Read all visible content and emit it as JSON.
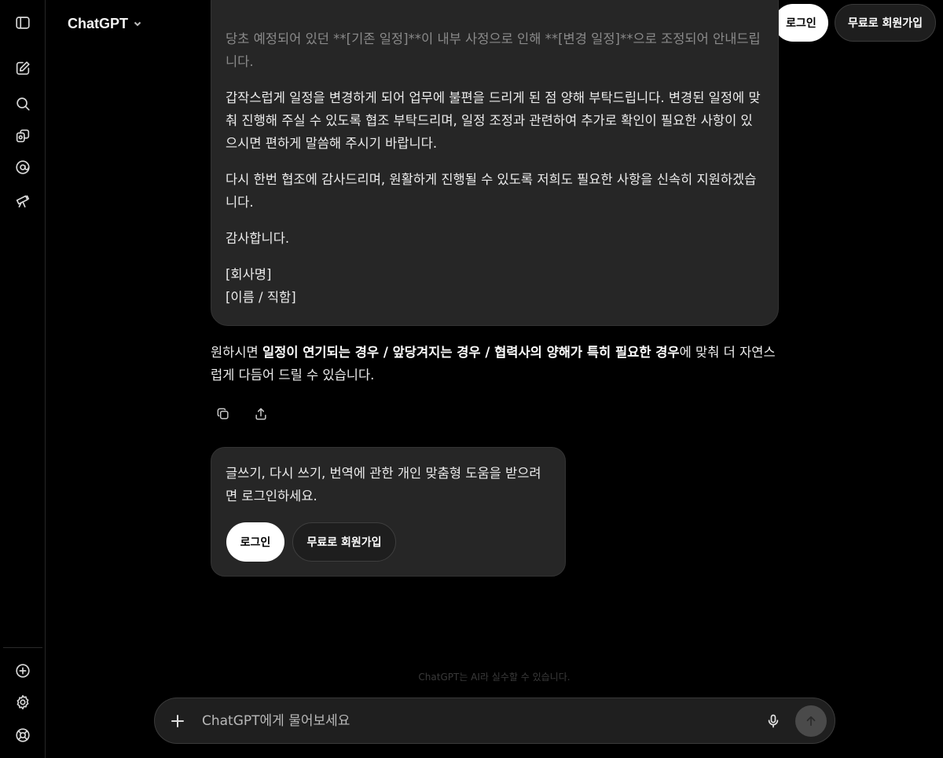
{
  "header": {
    "brand": "ChatGPT",
    "login_label": "로그인",
    "signup_label": "무료로 회원가입"
  },
  "sidebar": {
    "items": [
      {
        "icon": "sidebar-toggle-icon"
      },
      {
        "icon": "new-chat-icon"
      },
      {
        "icon": "search-icon"
      },
      {
        "icon": "library-icon"
      },
      {
        "icon": "mention-icon"
      },
      {
        "icon": "telescope-icon"
      }
    ],
    "bottom_items": [
      {
        "icon": "upgrade-icon"
      },
      {
        "icon": "gear-icon"
      },
      {
        "icon": "help-icon"
      }
    ]
  },
  "message": {
    "para1": "당초 예정되어 있던 **[기존 일정]**이 내부 사정으로 인해 **[변경 일정]**으로 조정되어 안내드립니다.",
    "para2": "갑작스럽게 일정을 변경하게 되어 업무에 불편을 드리게 된 점 양해 부탁드립니다. 변경된 일정에 맞춰 진행해 주실 수 있도록 협조 부탁드리며, 일정 조정과 관련하여 추가로 확인이 필요한 사항이 있으시면 편하게 말씀해 주시기 바랍니다.",
    "para3": "다시 한번 협조에 감사드리며, 원활하게 진행될 수 있도록 저희도 필요한 사항을 신속히 지원하겠습니다.",
    "para4": "감사합니다.",
    "sign_company": "[회사명]",
    "sign_name": "[이름 / 직함]"
  },
  "reply": {
    "prefix": "원하시면 ",
    "bold": "일정이 연기되는 경우 / 앞당겨지는 경우 / 협력사의 양해가 특히 필요한 경우",
    "suffix": "에 맞춰 더 자연스럽게 다듬어 드릴 수 있습니다."
  },
  "login_prompt": {
    "text": "글쓰기, 다시 쓰기, 번역에 관한 개인 맞춤형 도움을 받으려면 로그인하세요.",
    "login_label": "로그인",
    "signup_label": "무료로 회원가입"
  },
  "disclaimer": "ChatGPT는 AI라 실수할 수 있습니다.",
  "composer": {
    "placeholder": "ChatGPT에게 물어보세요"
  }
}
